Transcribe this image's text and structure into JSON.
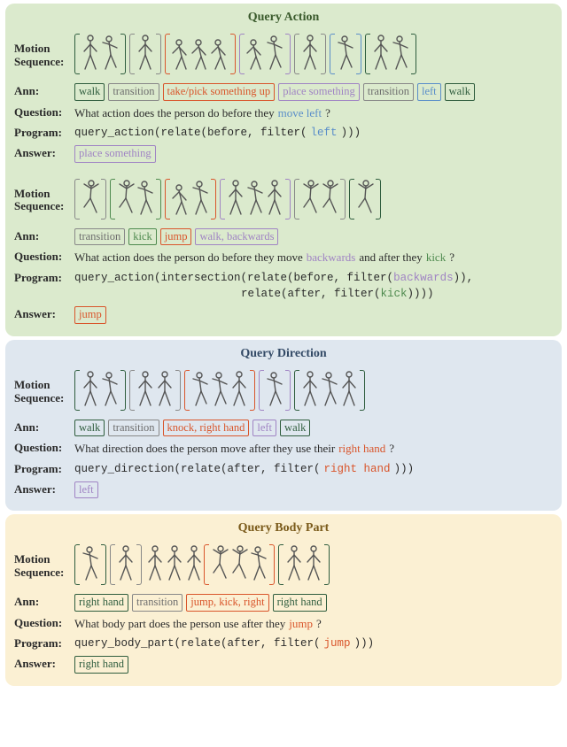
{
  "sections": {
    "action": {
      "title": "Query Action",
      "ex1": {
        "labels": {
          "motion": "Motion Sequence:",
          "ann": "Ann:",
          "question": "Question:",
          "program": "Program:",
          "answer": "Answer:"
        },
        "ann": {
          "walk": "walk",
          "transition": "transition",
          "take": "take/pick something up",
          "place": "place something",
          "transition2": "transition",
          "left": "left",
          "walk2": "walk"
        },
        "question": {
          "pre": "What action does the person do before they ",
          "hl": "move left",
          "post": "?"
        },
        "program": {
          "p1": "query_action(relate(before, filter(",
          "hl": "left",
          "p2": ")))"
        },
        "answer": "place something"
      },
      "ex2": {
        "labels": {
          "motion": "Motion Sequence:",
          "ann": "Ann:",
          "question": "Question:",
          "program": "Program:",
          "answer": "Answer:"
        },
        "ann": {
          "transition": "transition",
          "kick": "kick",
          "jump": "jump",
          "walkback": "walk, backwards"
        },
        "question": {
          "p1": "What action does the person do before they move ",
          "hl1": "backwards",
          "p2": " and after they ",
          "hl2": "kick",
          "p3": "?"
        },
        "program": {
          "l1a": "query_action(intersection(relate(before, filter(",
          "l1hl": "backwards",
          "l1b": ")),",
          "l2a": "relate(after, filter(",
          "l2hl": "kick",
          "l2b": "))))"
        },
        "answer": "jump"
      }
    },
    "direction": {
      "title": "Query Direction",
      "ex": {
        "labels": {
          "motion": "Motion Sequence:",
          "ann": "Ann:",
          "question": "Question:",
          "program": "Program:",
          "answer": "Answer:"
        },
        "ann": {
          "walk": "walk",
          "transition": "transition",
          "knock": "knock, right hand",
          "left": "left",
          "walk2": "walk"
        },
        "question": {
          "pre": "What direction does the person move after they use their ",
          "hl": "right hand",
          "post": "?"
        },
        "program": {
          "p1": "query_direction(relate(after, filter(",
          "hl": "right hand",
          "p2": ")))"
        },
        "answer": "left"
      }
    },
    "bodypart": {
      "title": "Query Body Part",
      "ex": {
        "labels": {
          "motion": "Motion Sequence:",
          "ann": "Ann:",
          "question": "Question:",
          "program": "Program:",
          "answer": "Answer:"
        },
        "ann": {
          "rh1": "right hand",
          "transition": "transition",
          "jump": "jump, kick, right",
          "rh2": "right hand"
        },
        "question": {
          "pre": "What body part does the person use after they ",
          "hl": "jump",
          "post": "?"
        },
        "program": {
          "p1": "query_body_part(relate(after, filter(",
          "hl": "jump",
          "p2": ")))"
        },
        "answer": "right hand"
      }
    }
  },
  "colors": {
    "dgreen": "#2f5d3e",
    "grey": "#888888",
    "orange": "#d9552b",
    "purple": "#a084c4",
    "blue": "#5a8ec9",
    "lgreen": "#4e8a4e"
  }
}
